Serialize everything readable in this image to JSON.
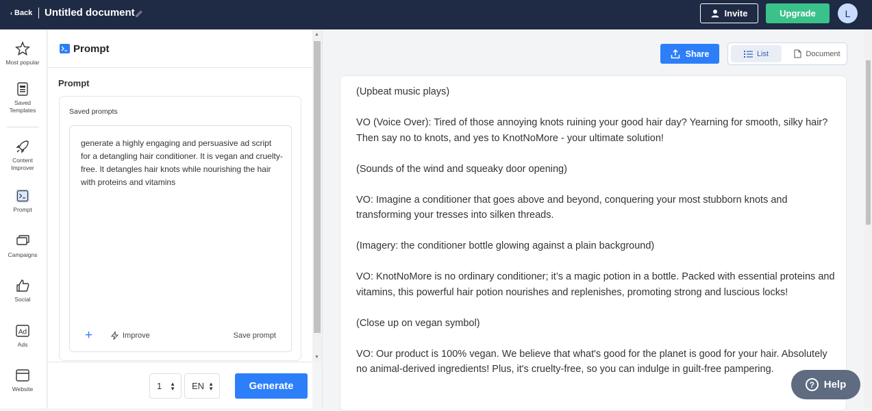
{
  "topbar": {
    "back_label": "Back",
    "doc_title": "Untitled document",
    "invite_label": "Invite",
    "upgrade_label": "Upgrade",
    "avatar_initial": "L",
    "bg_color": "#1f2a44",
    "upgrade_color": "#3ac28a"
  },
  "rail": {
    "items": [
      {
        "label": "Most popular",
        "icon": "star-icon"
      },
      {
        "label": "Saved Templates",
        "icon": "saved-templates-icon"
      },
      {
        "label": "Content Improver",
        "icon": "rocket-icon"
      },
      {
        "label": "Prompt",
        "icon": "terminal-icon"
      },
      {
        "label": "Campaigns",
        "icon": "campaigns-icon"
      },
      {
        "label": "Social",
        "icon": "thumbs-up-icon"
      },
      {
        "label": "Ads",
        "icon": "ad-icon"
      },
      {
        "label": "Website",
        "icon": "website-icon"
      }
    ]
  },
  "panel": {
    "title": "Prompt",
    "section_label": "Prompt",
    "saved_prompts_label": "Saved prompts",
    "prompt_text": "generate a highly engaging and persuasive ad script for a detangling hair conditioner. It is vegan and cruelty-free. It detangles hair knots while nourishing the hair with proteins and vitamins",
    "add_label": "+",
    "improve_label": "Improve",
    "save_prompt_label": "Save prompt",
    "count_value": "1",
    "lang_value": "EN",
    "generate_label": "Generate",
    "accent_color": "#2d7ff9"
  },
  "output": {
    "share_label": "Share",
    "list_label": "List",
    "document_label": "Document",
    "paragraphs": [
      "(Upbeat music plays)",
      "VO (Voice Over): Tired of those annoying knots ruining your good hair day? Yearning for smooth, silky hair? Then say no to knots, and yes to KnotNoMore - your ultimate solution!",
      "(Sounds of the wind and squeaky door opening)",
      "VO: Imagine a conditioner that goes above and beyond, conquering your most stubborn knots and transforming your tresses into silken threads.",
      "(Imagery: the conditioner bottle glowing against a plain background)",
      "VO: KnotNoMore is no ordinary conditioner; it’s a magic potion in a bottle. Packed with essential proteins and vitamins, this powerful hair potion nourishes and replenishes, promoting strong and luscious locks!",
      "(Close up on vegan symbol)",
      "VO: Our product is 100% vegan. We believe that what's good for the planet is good for your hair. Absolutely no animal-derived ingredients! Plus, it's cruelty-free, so you can indulge in guilt-free pampering."
    ],
    "help_label": "Help"
  }
}
